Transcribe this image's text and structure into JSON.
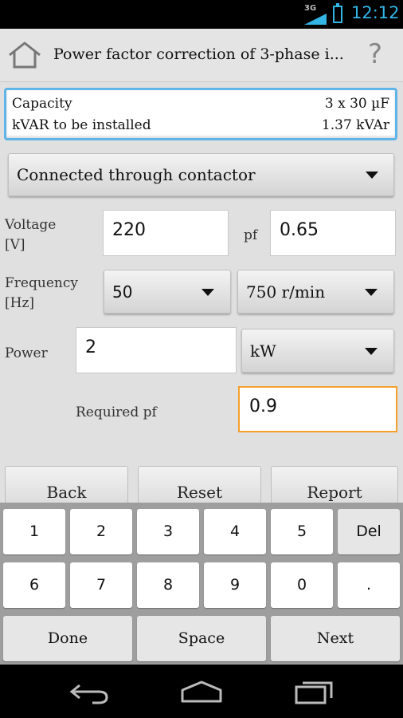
{
  "status_bar": {
    "network": "3G",
    "time": "12:12"
  },
  "header": {
    "title": "Power factor correction of 3-phase i..."
  },
  "results": [
    {
      "label": "Capacity",
      "value": "3 x 30 µF"
    },
    {
      "label": "kVAR to be installed",
      "value": "1.37 kVAr"
    }
  ],
  "connection": {
    "selected": "Connected through contactor"
  },
  "voltage": {
    "label_line1": "Voltage",
    "label_line2": "[V]",
    "value": "220"
  },
  "pf": {
    "label": "pf",
    "value": "0.65"
  },
  "frequency": {
    "label_line1": "Frequency",
    "label_line2": "[Hz]",
    "selected": "50"
  },
  "speed": {
    "selected": "750 r/min"
  },
  "power": {
    "label": "Power",
    "value": "2",
    "unit": "kW"
  },
  "required_pf": {
    "label": "Required pf",
    "value": "0.9"
  },
  "buttons": {
    "back": "Back",
    "reset": "Reset",
    "report": "Report"
  },
  "keyboard": {
    "row1": [
      "1",
      "2",
      "3",
      "4",
      "5",
      "Del"
    ],
    "row2": [
      "6",
      "7",
      "8",
      "9",
      "0",
      "."
    ],
    "row3": [
      "Done",
      "Space",
      "Next"
    ]
  }
}
